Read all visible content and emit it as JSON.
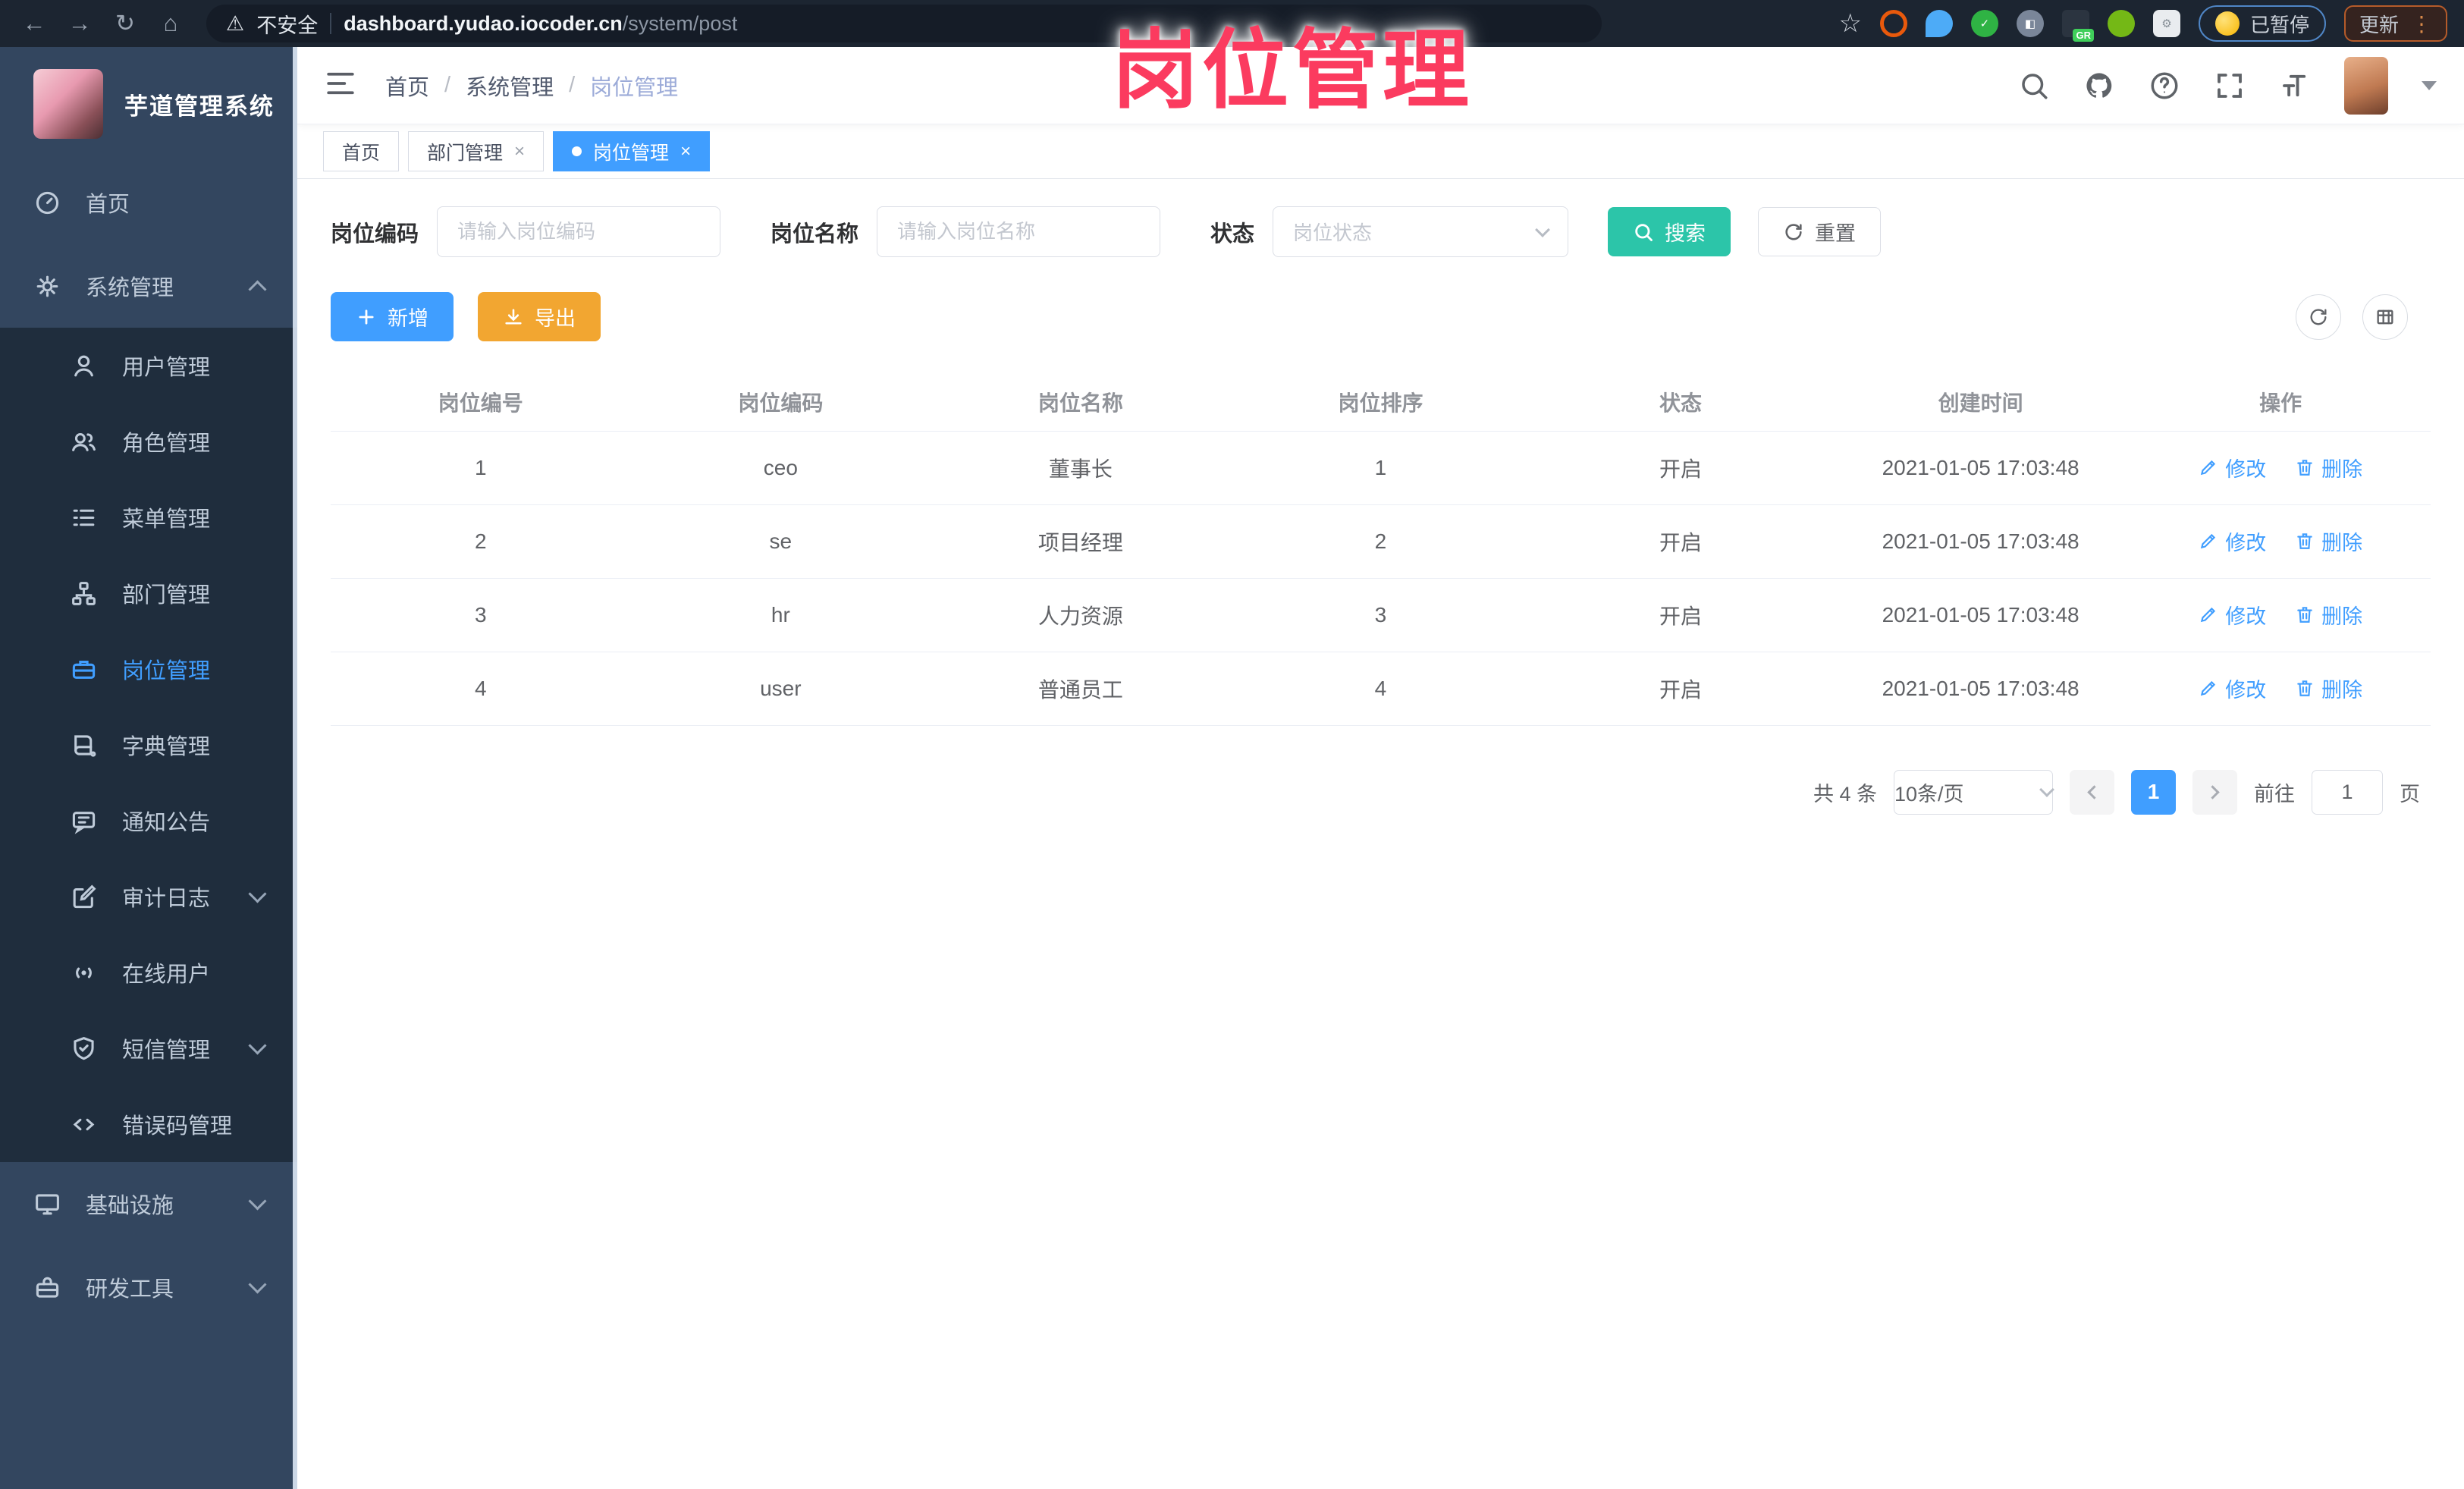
{
  "colors": {
    "accent": "#409eff",
    "search_teal": "#2cc5a9",
    "export_orange": "#f2a631",
    "watermark_pink": "#fb3b5f"
  },
  "watermark": "岗位管理",
  "browser": {
    "security_label": "不安全",
    "url_domain": "dashboard.yudao.iocoder.cn",
    "url_path": "/system/post",
    "paused_badge": "已暂停",
    "update_button": "更新"
  },
  "sidebar": {
    "logo_title": "芋道管理系统",
    "home_label": "首页",
    "system_label": "系统管理",
    "submenu": [
      "用户管理",
      "角色管理",
      "菜单管理",
      "部门管理",
      "岗位管理",
      "字典管理",
      "通知公告",
      "审计日志",
      "在线用户",
      "短信管理",
      "错误码管理"
    ],
    "infra_label": "基础设施",
    "devtools_label": "研发工具"
  },
  "navbar": {
    "breadcrumb": [
      "首页",
      "系统管理",
      "岗位管理"
    ]
  },
  "tabs": [
    {
      "label": "首页"
    },
    {
      "label": "部门管理"
    },
    {
      "label": "岗位管理"
    }
  ],
  "filters": {
    "code_label": "岗位编码",
    "code_placeholder": "请输入岗位编码",
    "name_label": "岗位名称",
    "name_placeholder": "请输入岗位名称",
    "status_label": "状态",
    "status_placeholder": "岗位状态",
    "search_label": "搜索",
    "reset_label": "重置"
  },
  "toolbar": {
    "add_label": "新增",
    "export_label": "导出"
  },
  "table": {
    "columns": [
      "岗位编号",
      "岗位编码",
      "岗位名称",
      "岗位排序",
      "状态",
      "创建时间",
      "操作"
    ],
    "edit_label": "修改",
    "delete_label": "删除",
    "rows": [
      {
        "id": "1",
        "code": "ceo",
        "name": "董事长",
        "sort": "1",
        "status": "开启",
        "created": "2021-01-05 17:03:48"
      },
      {
        "id": "2",
        "code": "se",
        "name": "项目经理",
        "sort": "2",
        "status": "开启",
        "created": "2021-01-05 17:03:48"
      },
      {
        "id": "3",
        "code": "hr",
        "name": "人力资源",
        "sort": "3",
        "status": "开启",
        "created": "2021-01-05 17:03:48"
      },
      {
        "id": "4",
        "code": "user",
        "name": "普通员工",
        "sort": "4",
        "status": "开启",
        "created": "2021-01-05 17:03:48"
      }
    ]
  },
  "pagination": {
    "total_text": "共 4 条",
    "page_size": "10条/页",
    "current_page": "1",
    "goto_label": "前往",
    "goto_value": "1",
    "page_unit": "页"
  }
}
